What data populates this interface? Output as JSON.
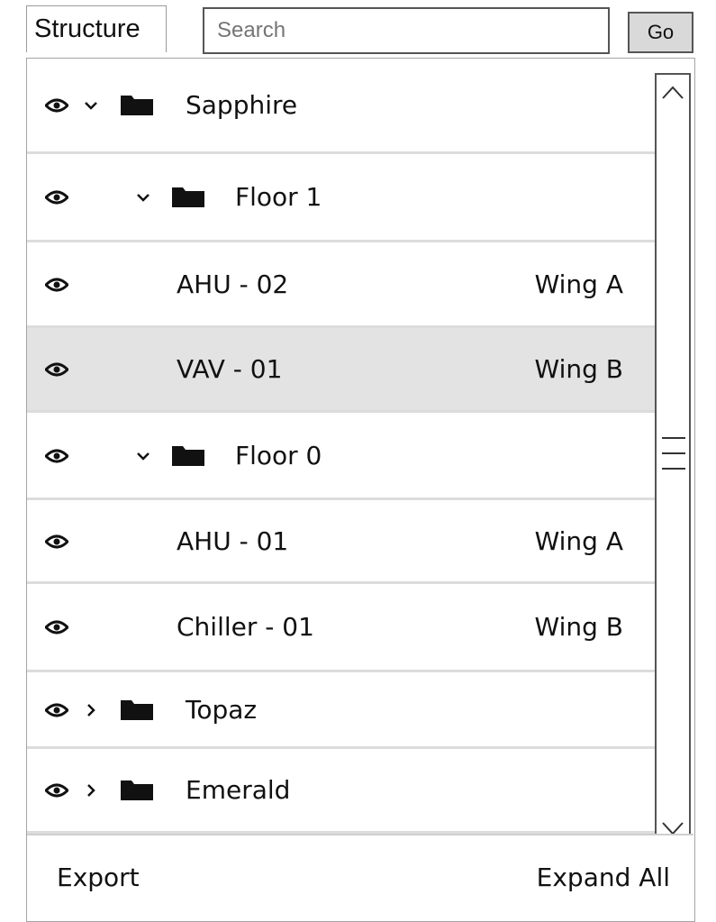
{
  "header": {
    "tab_label": "Structure",
    "search_placeholder": "Search",
    "go_label": "Go"
  },
  "tree": {
    "rows": [
      {
        "label": "Sapphire",
        "wing": "",
        "type": "folder",
        "expanded": true,
        "level": 0,
        "selected": false
      },
      {
        "label": "Floor 1",
        "wing": "",
        "type": "folder",
        "expanded": true,
        "level": 1,
        "selected": false
      },
      {
        "label": "AHU - 02",
        "wing": "Wing A",
        "type": "item",
        "level": 2,
        "selected": false
      },
      {
        "label": "VAV - 01",
        "wing": "Wing B",
        "type": "item",
        "level": 2,
        "selected": true
      },
      {
        "label": "Floor 0",
        "wing": "",
        "type": "folder",
        "expanded": true,
        "level": 1,
        "selected": false
      },
      {
        "label": "AHU - 01",
        "wing": "Wing A",
        "type": "item",
        "level": 2,
        "selected": false
      },
      {
        "label": "Chiller - 01",
        "wing": "Wing B",
        "type": "item",
        "level": 2,
        "selected": false
      },
      {
        "label": "Topaz",
        "wing": "",
        "type": "folder",
        "expanded": false,
        "level": 0,
        "selected": false
      },
      {
        "label": "Emerald",
        "wing": "",
        "type": "folder",
        "expanded": false,
        "level": 0,
        "selected": false
      }
    ]
  },
  "footer": {
    "export_label": "Export",
    "expand_all_label": "Expand All"
  },
  "icons": {
    "visibility": "eye-icon",
    "folder": "folder-icon",
    "expanded": "chevron-down-icon",
    "collapsed": "chevron-right-icon",
    "scroll_up": "arrow-up-icon",
    "scroll_down": "arrow-down-icon",
    "scroll_grip": "grip-icon"
  },
  "colors": {
    "selected_row": "#e3e3e3",
    "row_divider": "#dcdcdc",
    "button_bg": "#d9d9d9"
  }
}
